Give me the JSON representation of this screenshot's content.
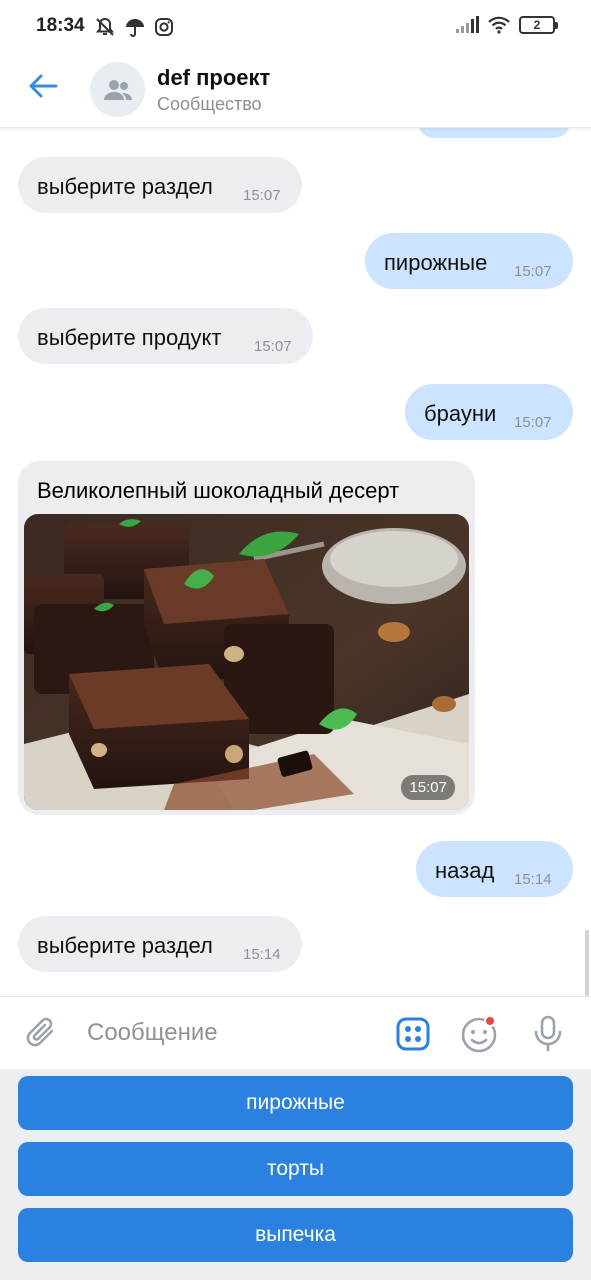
{
  "status_bar": {
    "time": "18:34",
    "battery": "2"
  },
  "header": {
    "title": "def проект",
    "subtitle": "Сообщество"
  },
  "messages": [
    {
      "direction": "in",
      "text": "выберите раздел",
      "time": "15:07"
    },
    {
      "direction": "out",
      "text": "пирожные",
      "time": "15:07"
    },
    {
      "direction": "in",
      "text": "выберите продукт",
      "time": "15:07"
    },
    {
      "direction": "out",
      "text": "брауни",
      "time": "15:07"
    },
    {
      "direction": "in",
      "text": "Великолепный шоколадный десерт",
      "time": "15:07",
      "has_photo": true
    },
    {
      "direction": "out",
      "text": "назад",
      "time": "15:14"
    },
    {
      "direction": "in",
      "text": "выберите раздел",
      "time": "15:14"
    }
  ],
  "composer": {
    "placeholder": "Сообщение"
  },
  "keyboard": {
    "buttons": [
      "пирожные",
      "торты",
      "выпечка"
    ]
  },
  "colors": {
    "accent": "#2a81e0",
    "incoming_bubble": "#ebedf0",
    "outgoing_bubble": "#cce4ff",
    "header_back_arrow": "#3a8be0"
  },
  "icons": [
    "mute-bell-icon",
    "umbrella-icon",
    "instagram-icon",
    "signal-icon",
    "wifi-icon",
    "battery-icon",
    "back-arrow-icon",
    "community-avatar-icon",
    "attach-paperclip-icon",
    "bot-keyboard-icon",
    "sticker-smile-icon",
    "microphone-icon"
  ]
}
